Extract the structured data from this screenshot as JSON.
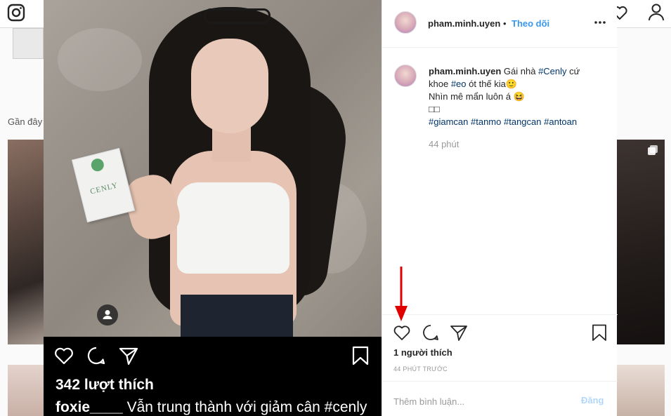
{
  "background": {
    "recent_label": "Gần đây"
  },
  "post": {
    "author": "pham.minh.uyen",
    "separator": "•",
    "follow_label": "Theo dõi",
    "caption_lines": [
      {
        "user": "pham.minh.uyen",
        "text": " Gái nhà ",
        "tag1": "#Cenly",
        "rest": " cứ"
      },
      {
        "text": "khoe ",
        "tag": "#eo",
        "rest": " ót thế kia🙂"
      },
      {
        "text": "Nhìn mê mẩn luôn á 😆"
      },
      {
        "text": "□□"
      },
      {
        "tags": [
          "#giamcan",
          "#tanmo",
          "#tangcan",
          "#antoan"
        ]
      }
    ],
    "caption_time": "44 phút",
    "likes_text": "1 người thích",
    "time_ago": "44 PHÚT TRƯỚC",
    "comment_placeholder": "Thêm bình luận...",
    "post_button": "Đăng"
  },
  "photo": {
    "product_brand": "CENLY",
    "overlay_likes": "342 lượt thích",
    "overlay_user": "foxie____",
    "overlay_text": " Vẫn trung thành với giảm cân #cenly"
  },
  "icons": {
    "like": "heart-icon",
    "comment": "comment-icon",
    "share": "share-icon",
    "save": "bookmark-icon",
    "more": "more-icon",
    "annotation": "red-arrow"
  },
  "colors": {
    "link": "#3897f0",
    "hashtag": "#003569",
    "annotation": "#e00000"
  }
}
